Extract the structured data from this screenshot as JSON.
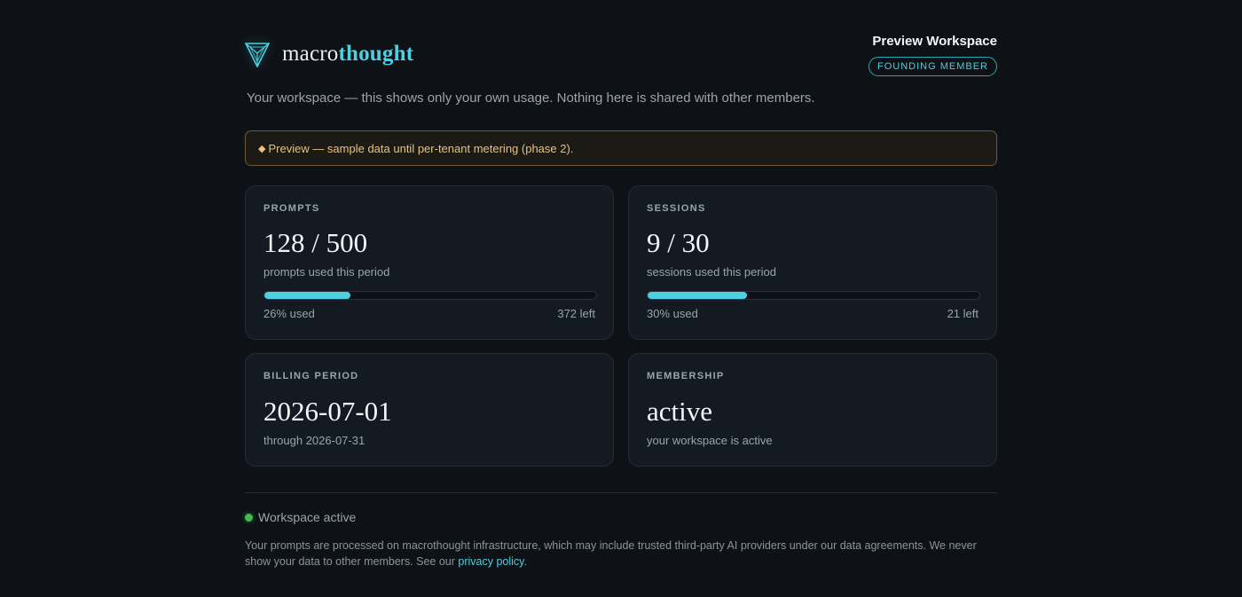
{
  "brand": {
    "prefix": "macro",
    "accent": "thought",
    "logo_icon": "triangle-logo-icon"
  },
  "workspace": {
    "title": "Preview Workspace",
    "badge": "FOUNDING MEMBER"
  },
  "subtitle": "Your workspace — this shows only your own usage. Nothing here is shared with other members.",
  "banner": {
    "icon": "◆",
    "text": "Preview — sample data until per-tenant metering (phase 2)."
  },
  "cards": {
    "prompts": {
      "label": "PROMPTS",
      "value": "128 / 500",
      "sub": "prompts used this period",
      "used_fraction": 0.26,
      "used_text": "26% used",
      "left_text": "372 left"
    },
    "sessions": {
      "label": "SESSIONS",
      "value": "9 / 30",
      "sub": "sessions used this period",
      "used_fraction": 0.3,
      "used_text": "30% used",
      "left_text": "21 left"
    },
    "billing": {
      "label": "BILLING PERIOD",
      "value": "2026-07-01",
      "sub": "through 2026-07-31"
    },
    "membership": {
      "label": "MEMBERSHIP",
      "value": "active",
      "sub": "your workspace is active"
    }
  },
  "status": {
    "text": "Workspace active",
    "color": "#3fb950"
  },
  "footer": {
    "text": "Your prompts are processed on macrothought infrastructure, which may include trusted third-party AI providers under our data agreements. We never show your data to other members. See our ",
    "link": "privacy policy",
    "end": "."
  },
  "colors": {
    "accent": "#4dd0e1",
    "background": "#0e1116",
    "card": "#141a22",
    "banner_text": "#e8c27a"
  }
}
